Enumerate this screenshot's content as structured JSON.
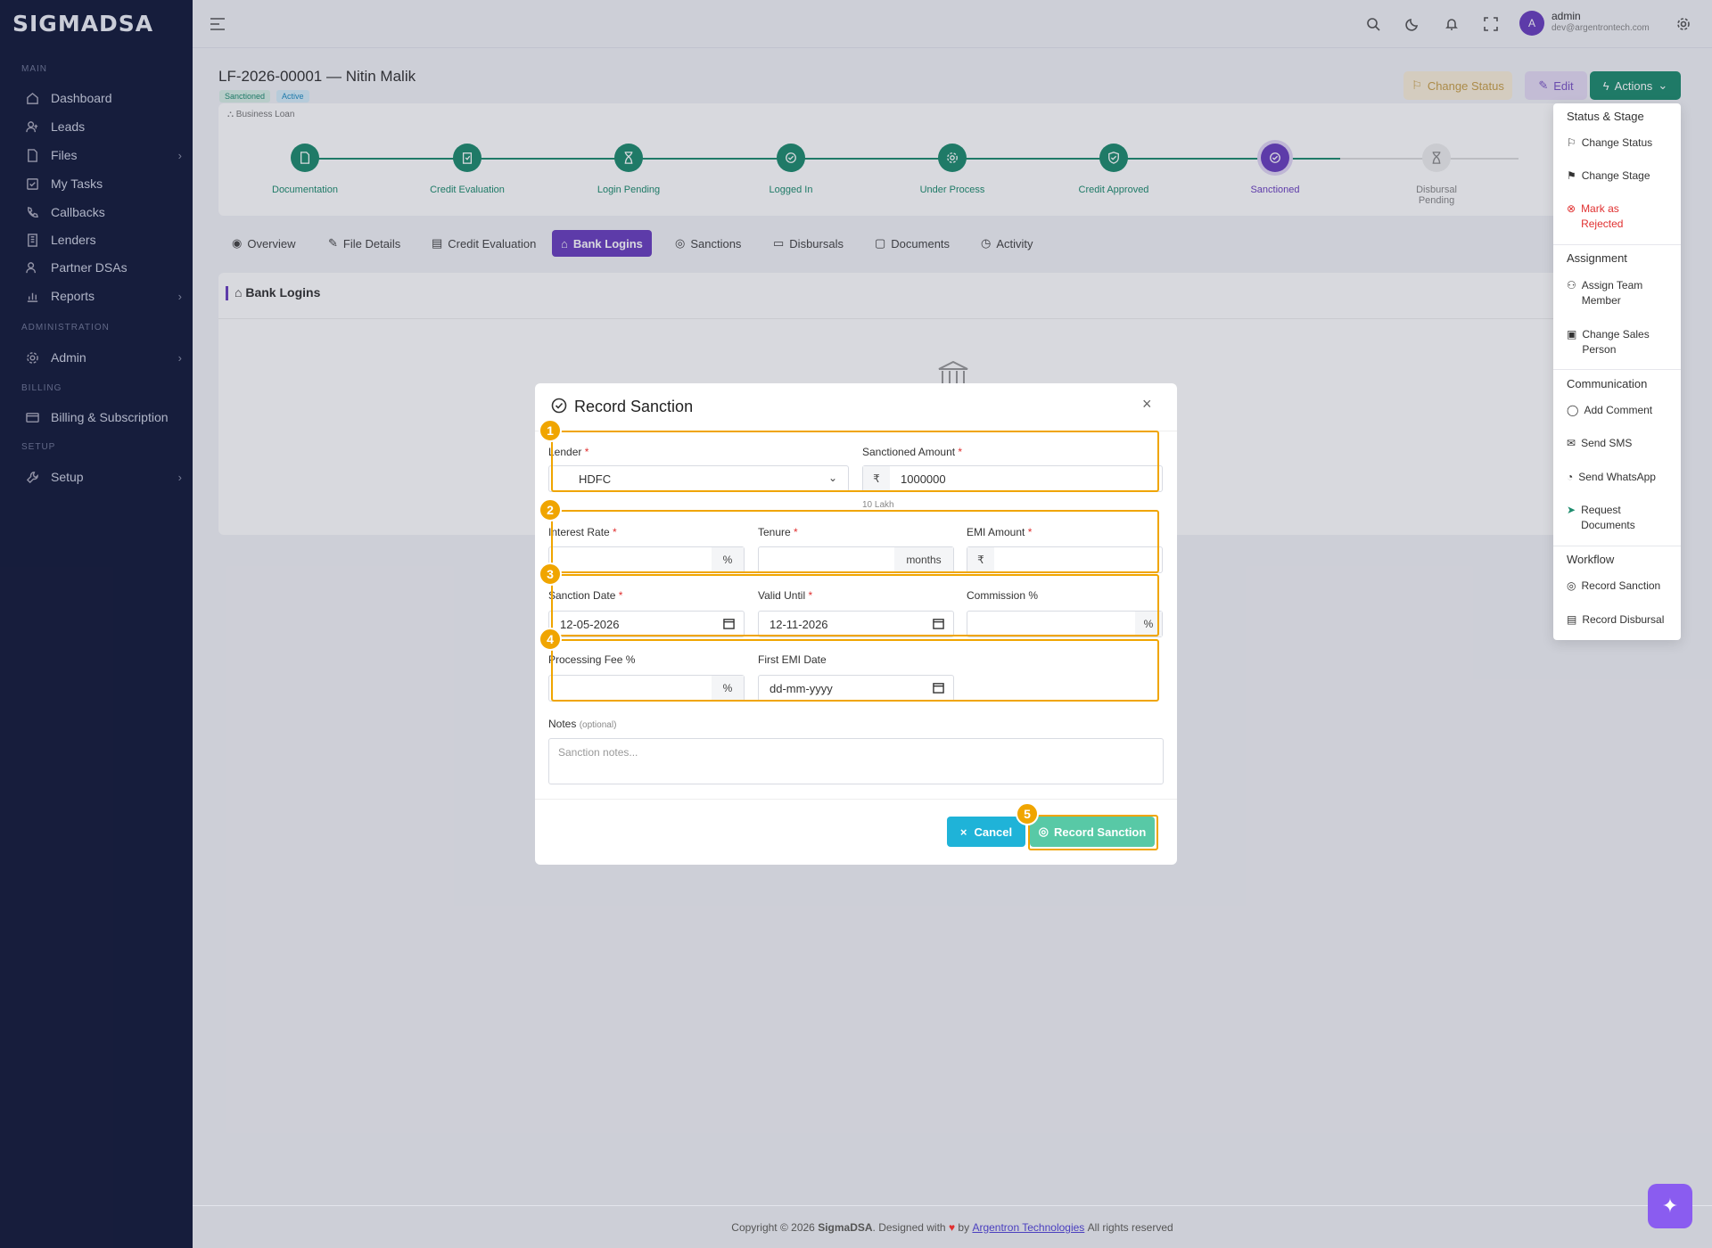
{
  "brand": {
    "logo": "SIGMADSA"
  },
  "sidebar": {
    "sections": {
      "main": "MAIN",
      "administration": "ADMINISTRATION",
      "billing": "BILLING",
      "setup": "SETUP"
    },
    "items": [
      {
        "label": "Dashboard",
        "icon": "home-icon"
      },
      {
        "label": "Leads",
        "icon": "user-plus-icon"
      },
      {
        "label": "Files",
        "icon": "file-icon"
      },
      {
        "label": "My Tasks",
        "icon": "tasks-icon"
      },
      {
        "label": "Callbacks",
        "icon": "phone-icon"
      },
      {
        "label": "Lenders",
        "icon": "building-icon"
      },
      {
        "label": "Partner DSAs",
        "icon": "users-icon"
      },
      {
        "label": "Reports",
        "icon": "chart-icon"
      },
      {
        "label": "Admin",
        "icon": "gear-icon"
      },
      {
        "label": "Billing & Subscription",
        "icon": "card-icon"
      },
      {
        "label": "Setup",
        "icon": "wrench-icon"
      }
    ]
  },
  "user": {
    "initial": "A",
    "name": "admin",
    "email": "dev@argentrontech.com"
  },
  "page": {
    "title": "LF-2026-00001 — Nitin Malik",
    "badges": [
      "Sanctioned",
      "Active"
    ],
    "loan_type": "Business Loan",
    "buttons": {
      "change_status": "Change Status",
      "edit": "Edit",
      "actions": "Actions"
    }
  },
  "stages": [
    {
      "label": "Documentation"
    },
    {
      "label": "Credit Evaluation"
    },
    {
      "label": "Login Pending"
    },
    {
      "label": "Logged In"
    },
    {
      "label": "Under Process"
    },
    {
      "label": "Credit Approved"
    },
    {
      "label": "Sanctioned"
    },
    {
      "label": "Disbursal Pending"
    }
  ],
  "tabs": [
    "Overview",
    "File Details",
    "Credit Evaluation",
    "Bank Logins",
    "Sanctions",
    "Disbursals",
    "Documents",
    "Activity"
  ],
  "active_tab": "Bank Logins",
  "panel": {
    "title": "Bank Logins"
  },
  "actions_menu": {
    "sections": [
      {
        "title": "Status & Stage",
        "items": [
          "Change Status",
          "Change Stage",
          "Mark as Rejected"
        ]
      },
      {
        "title": "Assignment",
        "items": [
          "Assign Team Member",
          "Change Sales Person"
        ]
      },
      {
        "title": "Communication",
        "items": [
          "Add Comment",
          "Send SMS",
          "Send WhatsApp",
          "Request Documents"
        ]
      },
      {
        "title": "Workflow",
        "items": [
          "Record Sanction",
          "Record Disbursal"
        ]
      }
    ]
  },
  "modal": {
    "title": "Record Sanction",
    "fields": {
      "lender": {
        "label": "Lender",
        "value": "HDFC"
      },
      "sanctioned_amount": {
        "label": "Sanctioned Amount",
        "prefix": "₹",
        "value": "1000000",
        "hint": "10 Lakh"
      },
      "interest_rate": {
        "label": "Interest Rate",
        "suffix": "%",
        "value": ""
      },
      "tenure": {
        "label": "Tenure",
        "suffix": "months",
        "value": ""
      },
      "emi_amount": {
        "label": "EMI Amount",
        "prefix": "₹",
        "value": ""
      },
      "sanction_date": {
        "label": "Sanction Date",
        "value": "12-05-2026"
      },
      "valid_until": {
        "label": "Valid Until",
        "value": "12-11-2026"
      },
      "commission": {
        "label": "Commission %",
        "suffix": "%",
        "value": ""
      },
      "processing_fee": {
        "label": "Processing Fee %",
        "suffix": "%",
        "value": ""
      },
      "first_emi_date": {
        "label": "First EMI Date",
        "placeholder": "dd-mm-yyyy"
      },
      "notes": {
        "label": "Notes",
        "optional": "(optional)",
        "placeholder": "Sanction notes..."
      }
    },
    "buttons": {
      "cancel": "Cancel",
      "submit": "Record Sanction"
    },
    "markers": [
      "1",
      "2",
      "3",
      "4",
      "5"
    ]
  },
  "footer": {
    "prefix": "Copyright © 2026",
    "brand": "SigmaDSA",
    "middle": ". Designed with",
    "by": "by",
    "company": "Argentron Technologies",
    "suffix": "All rights reserved"
  },
  "colors": {
    "sidebar": "#131a3a",
    "stage_done": "#1e8c6e",
    "stage_active": "#6a3fbf",
    "highlight": "#f0a500",
    "accent": "#1e8c6e",
    "cancel": "#1fb3d8"
  }
}
